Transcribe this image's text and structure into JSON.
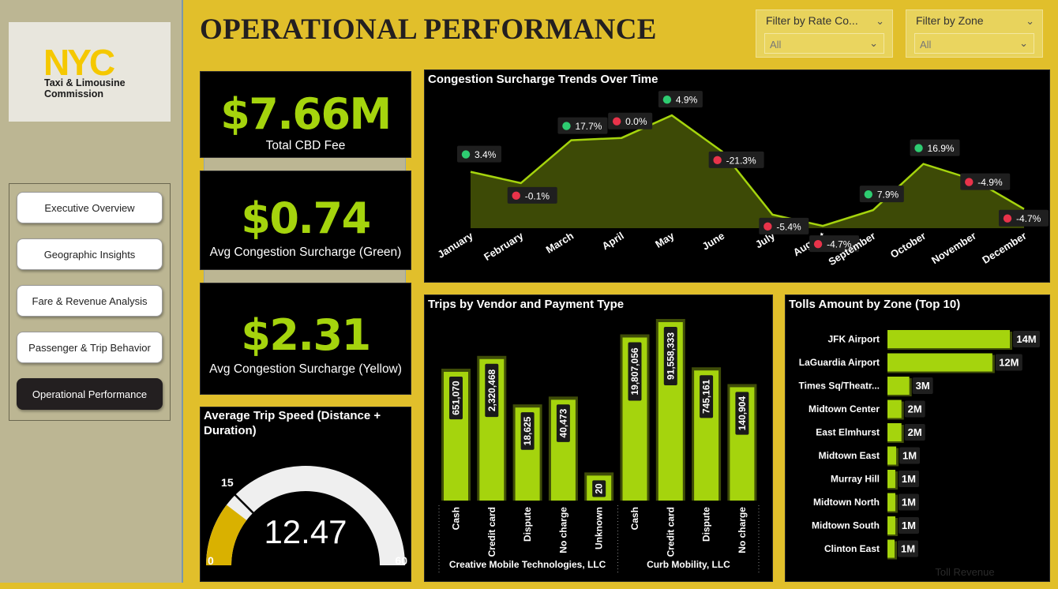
{
  "page": {
    "title": "OPERATIONAL PERFORMANCE"
  },
  "logo": {
    "mark": "NYC",
    "line1": "Taxi & Limousine",
    "line2": "Commission"
  },
  "nav": {
    "items": [
      {
        "label": "Executive Overview",
        "active": false
      },
      {
        "label": "Geographic Insights",
        "active": false
      },
      {
        "label": "Fare & Revenue Analysis",
        "active": false
      },
      {
        "label": "Passenger & Trip Behavior",
        "active": false
      },
      {
        "label": "Operational Performance",
        "active": true
      }
    ]
  },
  "filters": {
    "rate": {
      "title": "Filter by Rate Co...",
      "value": "All"
    },
    "zone": {
      "title": "Filter by Zone",
      "value": "All"
    }
  },
  "kpis": {
    "total_cbd": {
      "value": "$7.66M",
      "label": "Total CBD Fee"
    },
    "green": {
      "value": "$0.74",
      "label": "Avg Congestion Surcharge (Green)"
    },
    "yellow": {
      "value": "$2.31",
      "label": "Avg Congestion Surcharge (Yellow)"
    }
  },
  "gauge": {
    "title_line1": "Average Trip Speed (Distance +",
    "title_line2": "Duration)",
    "value": 12.47,
    "value_text": "12.47",
    "min": 0,
    "max": 60,
    "target": 15,
    "min_label": "0",
    "max_label": "60",
    "target_label": "15"
  },
  "colors": {
    "accent": "#a5d40d",
    "page_bg": "#e1bf2b",
    "sidebar_bg": "#bcb693",
    "up": "#2ecc71",
    "down": "#e8334a",
    "gauge_fill": "#d9b100"
  },
  "chart_data": [
    {
      "type": "area",
      "title": "Congestion Surcharge Trends Over Time",
      "categories": [
        "January",
        "February",
        "March",
        "April",
        "May",
        "June",
        "July",
        "August",
        "September",
        "October",
        "November",
        "December"
      ],
      "values": [
        5.0,
        4.0,
        7.8,
        8.0,
        10.0,
        6.8,
        1.2,
        0.2,
        1.6,
        5.7,
        4.3,
        1.7
      ],
      "value_note": "relative level; no value axis printed",
      "ylim": [
        0,
        10.5
      ],
      "pct_change": [
        "3.4%",
        "-0.1%",
        "17.7%",
        "0.0%",
        "4.9%",
        "-21.3%",
        "-5.4%",
        "-4.7%",
        "7.9%",
        "16.9%",
        "-4.9%",
        "-4.7%"
      ],
      "direction": [
        "up",
        "down",
        "up",
        "down",
        "up",
        "down",
        "down",
        "down",
        "up",
        "up",
        "down",
        "down"
      ]
    },
    {
      "type": "bar",
      "title": "Trips by Vendor and Payment Type",
      "groups": [
        {
          "name": "Creative Mobile Technologies, LLC",
          "categories": [
            "Cash",
            "Credit card",
            "Dispute",
            "No charge",
            "Unknown"
          ],
          "values": [
            651070,
            2320468,
            18625,
            40473,
            20
          ],
          "labels": [
            "651,070",
            "2,320,468",
            "18,625",
            "40,473",
            "20"
          ]
        },
        {
          "name": "Curb Mobility, LLC",
          "categories": [
            "Cash",
            "Credit card",
            "Dispute",
            "No charge"
          ],
          "values": [
            19807056,
            91558333,
            745161,
            140904
          ],
          "labels": [
            "19,807,056",
            "91,558,333",
            "745,161",
            "140,904"
          ]
        }
      ],
      "scale": "log"
    },
    {
      "type": "bar",
      "orientation": "horizontal",
      "title": "Tolls Amount by Zone (Top 10)",
      "xlabel": "Toll Revenue",
      "categories": [
        "JFK Airport",
        "LaGuardia Airport",
        "Times Sq/Theatr...",
        "Midtown Center",
        "East Elmhurst",
        "Midtown East",
        "Murray Hill",
        "Midtown North",
        "Midtown South",
        "Clinton East"
      ],
      "values": [
        14,
        12,
        2.5,
        1.6,
        1.6,
        1.0,
        0.9,
        0.9,
        0.9,
        0.8
      ],
      "labels": [
        "14M",
        "12M",
        "3M",
        "2M",
        "2M",
        "1M",
        "1M",
        "1M",
        "1M",
        "1M"
      ],
      "unit": "M"
    }
  ]
}
